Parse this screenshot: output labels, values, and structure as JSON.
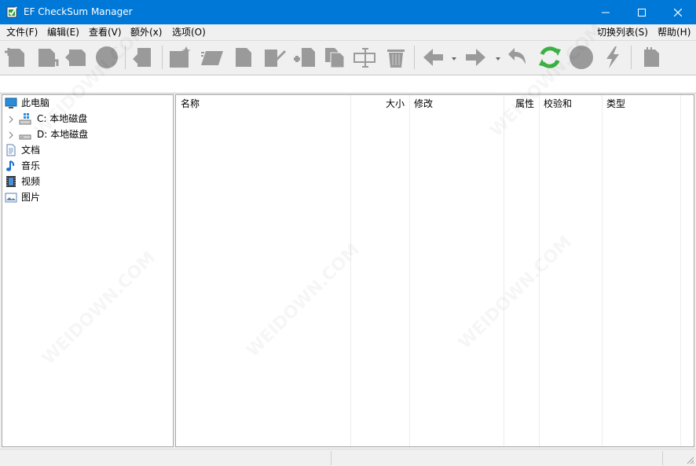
{
  "window": {
    "title": "EF CheckSum Manager",
    "accent": "#0078d7"
  },
  "menu": {
    "file": "文件(F)",
    "edit": "编辑(E)",
    "view": "查看(V)",
    "extra": "额外(x)",
    "options": "选项(O)",
    "switch_list": "切换列表(S)",
    "help": "帮助(H)"
  },
  "toolbar": {
    "icon_color": "#9a9a9a",
    "refresh_color": "#3cb043"
  },
  "tree": {
    "items": [
      {
        "label": "此电脑",
        "icon": "computer-icon"
      },
      {
        "label": "C: 本地磁盘",
        "icon": "drive-c-icon"
      },
      {
        "label": "D: 本地磁盘",
        "icon": "drive-d-icon"
      },
      {
        "label": "文档",
        "icon": "documents-icon"
      },
      {
        "label": "音乐",
        "icon": "music-icon"
      },
      {
        "label": "视频",
        "icon": "video-icon"
      },
      {
        "label": "图片",
        "icon": "pictures-icon"
      }
    ]
  },
  "list": {
    "columns": [
      {
        "label": "名称",
        "align": "left"
      },
      {
        "label": "大小",
        "align": "right"
      },
      {
        "label": "修改",
        "align": "left"
      },
      {
        "label": "属性",
        "align": "right"
      },
      {
        "label": "校验和",
        "align": "left"
      },
      {
        "label": "类型",
        "align": "left"
      }
    ]
  },
  "watermark": "WEIDOWN.COM"
}
